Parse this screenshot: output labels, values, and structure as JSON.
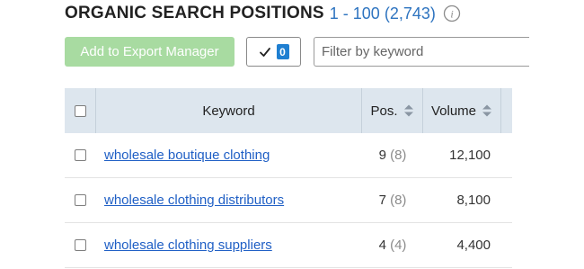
{
  "header": {
    "title": "ORGANIC SEARCH POSITIONS",
    "range": "1 - 100",
    "total": "(2,743)",
    "info_icon": "info-circle-icon"
  },
  "toolbar": {
    "export_label": "Add to Export Manager",
    "selected_count": "0",
    "check_icon": "checkmark-icon",
    "filter_placeholder": "Filter by keyword",
    "filter_value": ""
  },
  "table": {
    "columns": {
      "keyword": "Keyword",
      "pos": "Pos.",
      "volume": "Volume"
    },
    "rows": [
      {
        "keyword": "wholesale boutique clothing",
        "pos": "9",
        "prev_pos": "(8)",
        "volume": "12,100"
      },
      {
        "keyword": "wholesale clothing distributors",
        "pos": "7",
        "prev_pos": "(8)",
        "volume": "8,100"
      },
      {
        "keyword": "wholesale clothing suppliers",
        "pos": "4",
        "prev_pos": "(4)",
        "volume": "4,400"
      }
    ]
  },
  "colors": {
    "accent_blue": "#2e74c0",
    "export_button": "#a8dba1",
    "badge": "#1f7fd1",
    "header_bg": "#dde6ee",
    "link": "#1f5fc5"
  }
}
